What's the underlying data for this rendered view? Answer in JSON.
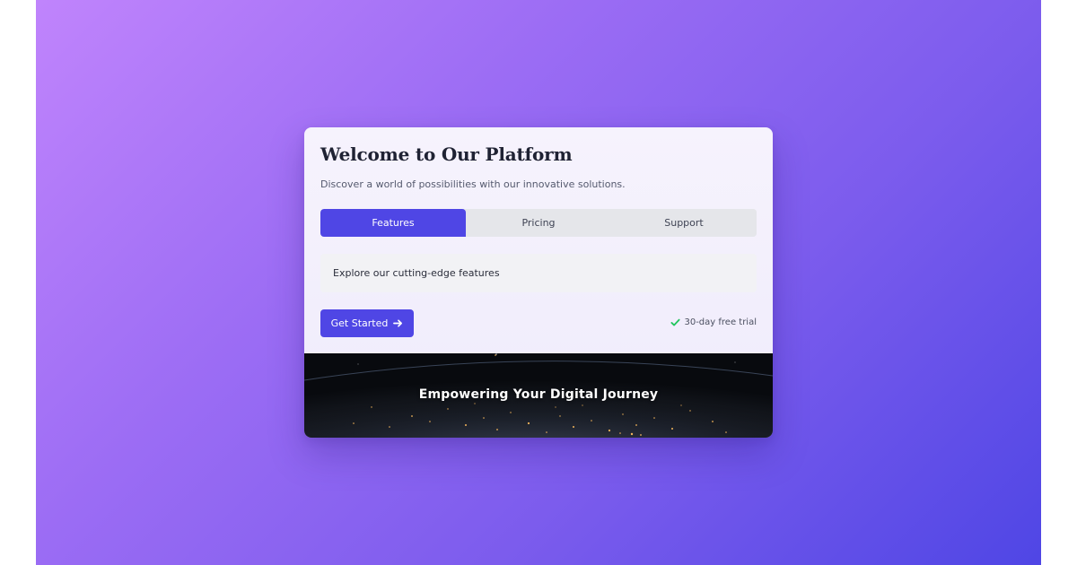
{
  "card": {
    "title": "Welcome to Our Platform",
    "subtitle": "Discover a world of possibilities with our innovative solutions."
  },
  "tabs": [
    {
      "label": "Features",
      "active": true
    },
    {
      "label": "Pricing",
      "active": false
    },
    {
      "label": "Support",
      "active": false
    }
  ],
  "panel": {
    "text": "Explore our cutting-edge features"
  },
  "cta": {
    "label": "Get Started",
    "icon": "arrow-right-icon"
  },
  "trial": {
    "label": "30-day free trial",
    "icon": "check-icon",
    "icon_color": "#22c55e"
  },
  "banner": {
    "text": "Empowering Your Digital Journey",
    "image": "earth-at-night"
  },
  "colors": {
    "accent": "#4f46e5",
    "background_start": "#c084fc",
    "background_end": "#4f46e5"
  }
}
